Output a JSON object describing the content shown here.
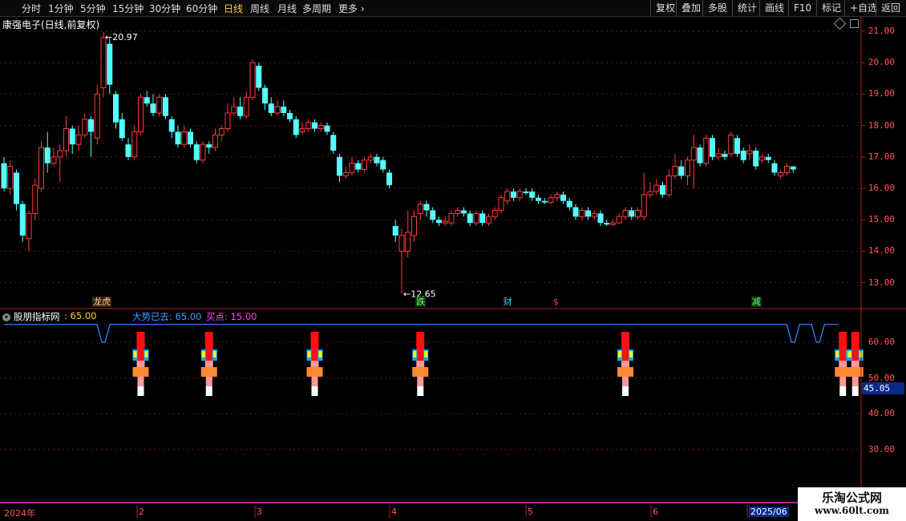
{
  "toolbar": {
    "periods": [
      "分时",
      "1分钟",
      "5分钟",
      "15分钟",
      "30分钟",
      "60分钟",
      "日线",
      "周线",
      "月线",
      "多周期",
      "更多"
    ],
    "active_period": "日线",
    "right_buttons": [
      "复权",
      "叠加",
      "多股",
      "统计",
      "画线",
      "F10",
      "标记",
      "+自选",
      "返回"
    ]
  },
  "stock": {
    "title": "康强电子(日线,前复权)"
  },
  "price_axis": {
    "labels": [
      "21.00",
      "20.00",
      "19.00",
      "18.00",
      "17.00",
      "16.00",
      "15.00",
      "14.00",
      "13.00"
    ]
  },
  "annotations": {
    "high": "20.97",
    "low": "12.65"
  },
  "news_tags": [
    "龙虎",
    "跌",
    "财",
    "$",
    "减"
  ],
  "indicator": {
    "name": "股朋指标网",
    "name_value": ": 65.00",
    "line1": "大势已去: 65.00",
    "line2": "买点: 15.00",
    "axis_labels": [
      "60.00",
      "50.00",
      "40.00",
      "30.00"
    ],
    "current_value": "45.05"
  },
  "date_axis": {
    "labels": [
      "2024年",
      "2",
      "3",
      "4",
      "5",
      "6",
      "2025/06"
    ]
  },
  "watermark": {
    "line1": "乐淘公式网",
    "line2": "www.60lt.com"
  },
  "colors": {
    "up": "#ff3b3b",
    "down": "#54ffff",
    "line": "#3a7fff",
    "signal_red": "#ff1010",
    "signal_yellow": "#ffff00",
    "signal_blue": "#00aaff",
    "background": "#000000"
  },
  "chart_data": {
    "type": "candlestick",
    "ylim": [
      12.5,
      21.3
    ],
    "candles": [
      [
        16.8,
        16.0,
        17.0,
        15.9
      ],
      [
        16.0,
        16.7,
        16.9,
        15.8
      ],
      [
        16.5,
        15.5,
        16.6,
        15.3
      ],
      [
        15.5,
        14.5,
        15.6,
        14.3
      ],
      [
        14.4,
        15.2,
        15.3,
        14.0
      ],
      [
        15.2,
        16.1,
        16.3,
        15.0
      ],
      [
        16.0,
        17.3,
        17.5,
        15.9
      ],
      [
        17.3,
        16.8,
        17.8,
        16.5
      ],
      [
        16.8,
        17.0,
        17.3,
        16.7
      ],
      [
        17.0,
        17.2,
        17.4,
        16.2
      ],
      [
        17.2,
        17.9,
        18.3,
        17.0
      ],
      [
        17.9,
        17.4,
        18.0,
        17.1
      ],
      [
        17.4,
        17.7,
        18.0,
        17.2
      ],
      [
        17.7,
        18.2,
        18.4,
        17.6
      ],
      [
        18.2,
        17.8,
        18.3,
        17.0
      ],
      [
        17.6,
        19.0,
        19.3,
        17.4
      ],
      [
        19.2,
        20.8,
        20.97,
        18.9
      ],
      [
        20.6,
        19.3,
        20.8,
        19.0
      ],
      [
        19.0,
        18.1,
        19.1,
        17.9
      ],
      [
        18.2,
        17.6,
        18.4,
        17.5
      ],
      [
        17.4,
        17.0,
        17.6,
        16.9
      ],
      [
        17.0,
        17.8,
        18.0,
        16.9
      ],
      [
        17.8,
        18.9,
        19.0,
        17.7
      ],
      [
        18.9,
        18.7,
        19.1,
        18.6
      ],
      [
        18.7,
        18.4,
        19.0,
        18.3
      ],
      [
        18.4,
        18.9,
        19.0,
        18.3
      ],
      [
        18.9,
        18.3,
        19.0,
        18.2
      ],
      [
        18.2,
        17.8,
        18.3,
        17.6
      ],
      [
        17.8,
        17.4,
        18.0,
        17.3
      ],
      [
        17.4,
        17.8,
        18.0,
        17.3
      ],
      [
        17.8,
        17.4,
        17.9,
        17.3
      ],
      [
        17.4,
        16.9,
        17.5,
        16.8
      ],
      [
        16.9,
        17.4,
        17.5,
        16.8
      ],
      [
        17.4,
        17.3,
        17.5,
        17.1
      ],
      [
        17.3,
        17.7,
        17.9,
        17.2
      ],
      [
        17.7,
        17.9,
        18.0,
        17.5
      ],
      [
        17.9,
        18.4,
        18.7,
        17.8
      ],
      [
        18.4,
        18.6,
        18.9,
        18.3
      ],
      [
        18.6,
        18.3,
        18.9,
        18.2
      ],
      [
        18.3,
        18.9,
        19.1,
        18.2
      ],
      [
        18.9,
        20.0,
        20.1,
        18.8
      ],
      [
        19.9,
        19.2,
        20.0,
        19.1
      ],
      [
        19.2,
        18.7,
        19.3,
        18.5
      ],
      [
        18.7,
        18.4,
        18.9,
        18.3
      ],
      [
        18.4,
        18.6,
        18.8,
        18.3
      ],
      [
        18.6,
        18.4,
        18.8,
        18.3
      ],
      [
        18.4,
        18.2,
        18.5,
        18.1
      ],
      [
        18.2,
        17.7,
        18.3,
        17.6
      ],
      [
        17.8,
        17.9,
        18.1,
        17.7
      ],
      [
        17.9,
        18.1,
        18.2,
        17.8
      ],
      [
        18.1,
        17.9,
        18.2,
        17.8
      ],
      [
        17.9,
        18.0,
        18.1,
        17.8
      ],
      [
        18.0,
        17.8,
        18.1,
        17.7
      ],
      [
        17.7,
        17.2,
        17.8,
        17.1
      ],
      [
        17.0,
        16.4,
        17.1,
        16.2
      ],
      [
        16.4,
        16.5,
        16.7,
        16.3
      ],
      [
        16.5,
        16.8,
        17.0,
        16.4
      ],
      [
        16.8,
        16.6,
        16.9,
        16.5
      ],
      [
        16.6,
        16.9,
        17.0,
        16.5
      ],
      [
        16.9,
        17.0,
        17.1,
        16.8
      ],
      [
        17.0,
        16.8,
        17.1,
        16.7
      ],
      [
        16.9,
        16.6,
        17.0,
        16.5
      ],
      [
        16.5,
        16.1,
        16.6,
        16.0
      ],
      [
        14.8,
        14.5,
        15.0,
        14.3
      ],
      [
        14.0,
        14.5,
        14.7,
        12.65
      ],
      [
        14.0,
        14.6,
        15.3,
        13.8
      ],
      [
        14.5,
        15.1,
        15.3,
        14.3
      ],
      [
        15.2,
        15.5,
        15.6,
        15.0
      ],
      [
        15.5,
        15.3,
        15.6,
        15.1
      ],
      [
        15.3,
        15.0,
        15.4,
        14.9
      ],
      [
        15.0,
        14.9,
        15.1,
        14.8
      ],
      [
        14.9,
        14.95,
        15.1,
        14.8
      ],
      [
        14.9,
        15.2,
        15.3,
        14.8
      ],
      [
        15.2,
        15.3,
        15.4,
        15.1
      ],
      [
        15.3,
        15.2,
        15.4,
        15.1
      ],
      [
        15.2,
        14.9,
        15.3,
        14.8
      ],
      [
        14.9,
        15.2,
        15.3,
        14.8
      ],
      [
        15.2,
        14.9,
        15.3,
        14.8
      ],
      [
        14.9,
        15.1,
        15.2,
        14.8
      ],
      [
        15.1,
        15.3,
        15.4,
        15.0
      ],
      [
        15.3,
        15.7,
        15.8,
        15.2
      ],
      [
        15.6,
        15.9,
        16.0,
        15.5
      ],
      [
        15.9,
        15.7,
        16.0,
        15.6
      ],
      [
        15.7,
        15.9,
        16.0,
        15.6
      ],
      [
        15.9,
        15.85,
        16.0,
        15.8
      ],
      [
        15.9,
        15.7,
        16.0,
        15.6
      ],
      [
        15.7,
        15.6,
        15.8,
        15.5
      ],
      [
        15.6,
        15.55,
        15.7,
        15.5
      ],
      [
        15.55,
        15.7,
        15.8,
        15.5
      ],
      [
        15.7,
        15.8,
        15.9,
        15.6
      ],
      [
        15.8,
        15.6,
        15.9,
        15.5
      ],
      [
        15.6,
        15.4,
        15.7,
        15.3
      ],
      [
        15.4,
        15.1,
        15.5,
        15.0
      ],
      [
        15.1,
        15.3,
        15.4,
        15.0
      ],
      [
        15.3,
        15.1,
        15.4,
        15.0
      ],
      [
        15.1,
        15.2,
        15.3,
        15.0
      ],
      [
        15.2,
        14.9,
        15.3,
        14.8
      ],
      [
        14.9,
        14.85,
        15.0,
        14.8
      ],
      [
        14.85,
        14.9,
        15.0,
        14.8
      ],
      [
        14.9,
        15.1,
        15.2,
        14.9
      ],
      [
        15.1,
        15.3,
        15.4,
        15.0
      ],
      [
        15.3,
        15.1,
        15.4,
        15.0
      ],
      [
        15.1,
        15.3,
        15.4,
        15.0
      ],
      [
        15.1,
        15.8,
        16.5,
        15.0
      ],
      [
        15.8,
        15.9,
        16.2,
        15.7
      ],
      [
        15.9,
        16.1,
        16.3,
        15.8
      ],
      [
        16.1,
        15.8,
        16.2,
        15.7
      ],
      [
        15.8,
        16.4,
        16.6,
        15.7
      ],
      [
        16.4,
        16.7,
        17.1,
        16.3
      ],
      [
        16.7,
        16.4,
        16.9,
        16.3
      ],
      [
        16.4,
        16.9,
        17.0,
        16.1
      ],
      [
        16.9,
        17.3,
        17.7,
        16.0
      ],
      [
        17.3,
        16.8,
        17.4,
        16.7
      ],
      [
        16.8,
        17.6,
        17.7,
        16.7
      ],
      [
        17.6,
        17.0,
        17.7,
        16.9
      ],
      [
        17.0,
        17.1,
        17.3,
        16.9
      ],
      [
        17.1,
        17.0,
        17.2,
        16.9
      ],
      [
        17.1,
        17.7,
        17.8,
        17.0
      ],
      [
        17.6,
        17.1,
        17.7,
        17.0
      ],
      [
        17.2,
        16.9,
        17.3,
        16.8
      ],
      [
        17.1,
        17.2,
        17.4,
        16.9
      ],
      [
        17.2,
        16.7,
        17.3,
        16.6
      ],
      [
        16.9,
        17.0,
        17.1,
        16.8
      ],
      [
        17.0,
        16.9,
        17.1,
        16.8
      ],
      [
        16.8,
        16.5,
        16.9,
        16.4
      ],
      [
        16.4,
        16.5,
        16.6,
        16.3
      ],
      [
        16.5,
        16.7,
        16.8,
        16.4
      ],
      [
        16.7,
        16.6,
        16.7,
        16.5
      ]
    ],
    "indicator_series": {
      "line_base": 65,
      "dips": [
        {
          "index": 16,
          "value": 60
        },
        {
          "index": 127,
          "value": 60
        },
        {
          "index": 131,
          "value": 60
        }
      ]
    },
    "buy_signals": [
      22,
      33,
      50,
      67,
      100,
      135,
      137
    ],
    "indicator_ylim": [
      25,
      68
    ],
    "news_tag_indices": [
      15,
      67,
      81,
      89,
      121
    ]
  }
}
